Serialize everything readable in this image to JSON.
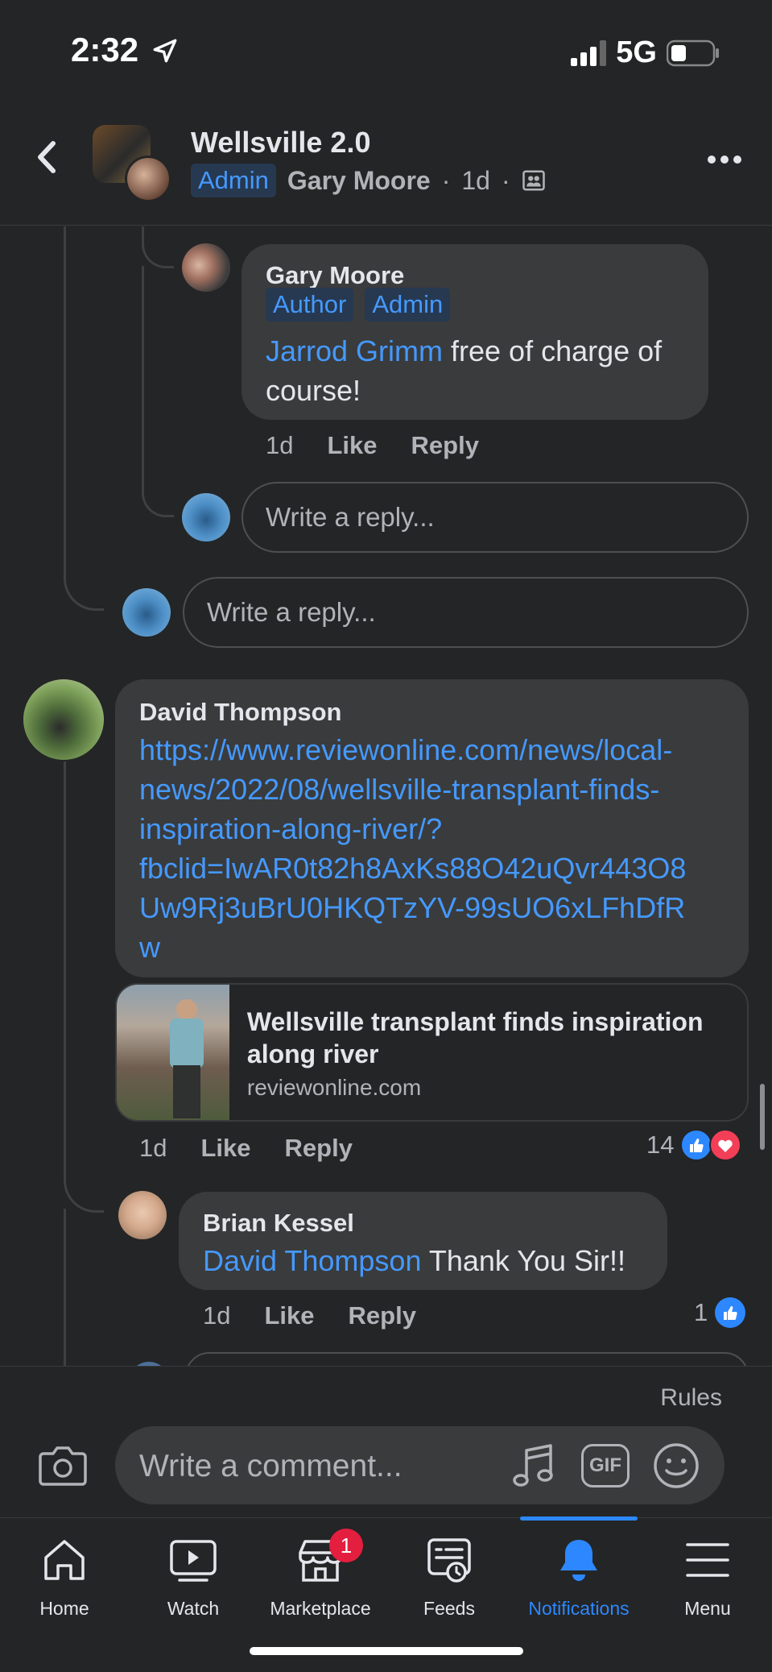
{
  "status": {
    "time": "2:32",
    "network": "5G"
  },
  "header": {
    "group_name": "Wellsville 2.0",
    "admin_badge": "Admin",
    "author": "Gary Moore",
    "time": "1d",
    "separator": "·"
  },
  "comments": {
    "gary": {
      "name": "Gary Moore",
      "badges": [
        "Author",
        "Admin"
      ],
      "mention": "Jarrod Grimm",
      "text": " free of charge of course!",
      "time": "1d",
      "like": "Like",
      "reply": "Reply"
    },
    "reply_placeholder_1": "Write a reply...",
    "reply_placeholder_2": "Write a reply...",
    "david": {
      "name": "David Thompson",
      "link": "https://www.reviewonline.com/news/local-news/2022/08/wellsville-transplant-finds-inspiration-along-river/?fbclid=IwAR0t82h8AxKs88O42uQvr443O8Uw9Rj3uBrU0HKQTzYV-99sUO6xLFhDfRw",
      "link_lines": [
        "https://www.reviewonline.com/news/local-",
        "news/2022/08/wellsville-transplant-finds-",
        "inspiration-along-river/?",
        "fbclid=IwAR0t82h8AxKs88O42uQvr443O8",
        "Uw9Rj3uBrU0HKQTzYV-99sUO6xLFhDfR",
        "w"
      ],
      "card_title": "Wellsville transplant finds inspiration along river",
      "card_domain": "reviewonline.com",
      "time": "1d",
      "like": "Like",
      "reply": "Reply",
      "reaction_count": "14"
    },
    "brian": {
      "name": "Brian Kessel",
      "mention": "David Thompson",
      "text": " Thank You Sir!!",
      "time": "1d",
      "like": "Like",
      "reply": "Reply",
      "reaction_count": "1"
    }
  },
  "composer": {
    "rules": "Rules",
    "placeholder": "Write a comment...",
    "gif": "GIF"
  },
  "tabs": [
    {
      "label": "Home"
    },
    {
      "label": "Watch"
    },
    {
      "label": "Marketplace",
      "badge": "1"
    },
    {
      "label": "Feeds"
    },
    {
      "label": "Notifications"
    },
    {
      "label": "Menu"
    }
  ],
  "colors": {
    "accent": "#2d88ff",
    "link": "#4599ff",
    "love": "#f33e58",
    "badge": "#e41e3f"
  }
}
